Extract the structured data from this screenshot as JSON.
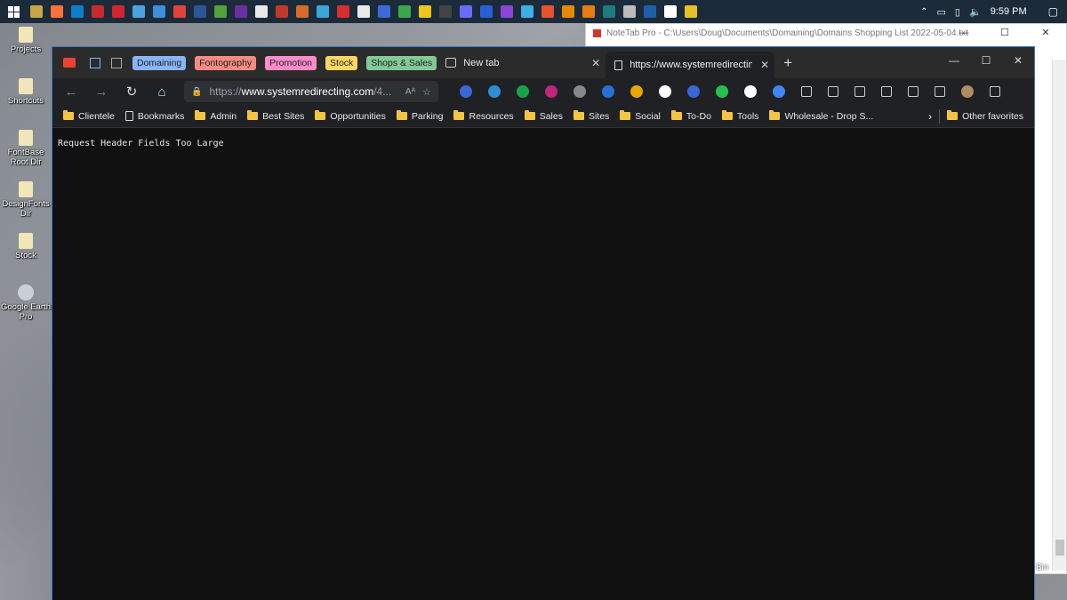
{
  "taskbar": {
    "time": "9:59 PM",
    "icons": [
      "#c7a64a",
      "#ff7139",
      "#0f7dcc",
      "#c62b2b",
      "#d0252f",
      "#4aa3df",
      "#3d8fd8",
      "#e0433c",
      "#2b5797",
      "#4fa33a",
      "#6b2fa3",
      "#e8e8e8",
      "#c0392b",
      "#d96b2a",
      "#3aa7d9",
      "#d92e2e",
      "#eaeaea",
      "#3c6bd9",
      "#3aa84a",
      "#f0c419",
      "#444",
      "#6a6aff",
      "#2a5fd9",
      "#8b46d9",
      "#3ab0e6",
      "#e6532a",
      "#e68a00",
      "#e87d0d",
      "#1d7c7c",
      "#bbb",
      "#1d5fa8",
      "#fff",
      "#e6c229"
    ]
  },
  "desktop": [
    {
      "label": "Projects"
    },
    {
      "label": "Shortcuts"
    },
    {
      "label": "FontBase Root Dir"
    },
    {
      "label": "DesignFonts Dir"
    },
    {
      "label": "Stock"
    },
    {
      "label": "Google Earth Pro"
    }
  ],
  "notetab": {
    "title": "NoteTab Pro  -  C:\\Users\\Doug\\Documents\\Domaining\\Domains Shopping List 2022-05-04.txt",
    "bin_label": "Bin"
  },
  "browser": {
    "tab_groups": [
      {
        "label": "Domaining",
        "color": "#8ab4f8"
      },
      {
        "label": "Fontography",
        "color": "#f28b82"
      },
      {
        "label": "Promotion",
        "color": "#ff8bcb"
      },
      {
        "label": "Stock",
        "color": "#fdd663"
      },
      {
        "label": "Shops & Sales",
        "color": "#81c995"
      }
    ],
    "inactive_tab": {
      "title": "New tab"
    },
    "active_tab": {
      "title": "https://www.systemredirecting.co"
    },
    "address": {
      "proto": "https://",
      "host": "www.systemredirecting.com",
      "path": "/4..."
    },
    "bookmarks": [
      "Clientele",
      "Bookmarks",
      "Admin",
      "Best Sites",
      "Opportunities",
      "Parking",
      "Resources",
      "Sales",
      "Sites",
      "Social",
      "To-Do",
      "Tools",
      "Wholesale - Drop S..."
    ],
    "other_favorites": "Other favorites",
    "page_text": "Request Header Fields Too Large"
  }
}
